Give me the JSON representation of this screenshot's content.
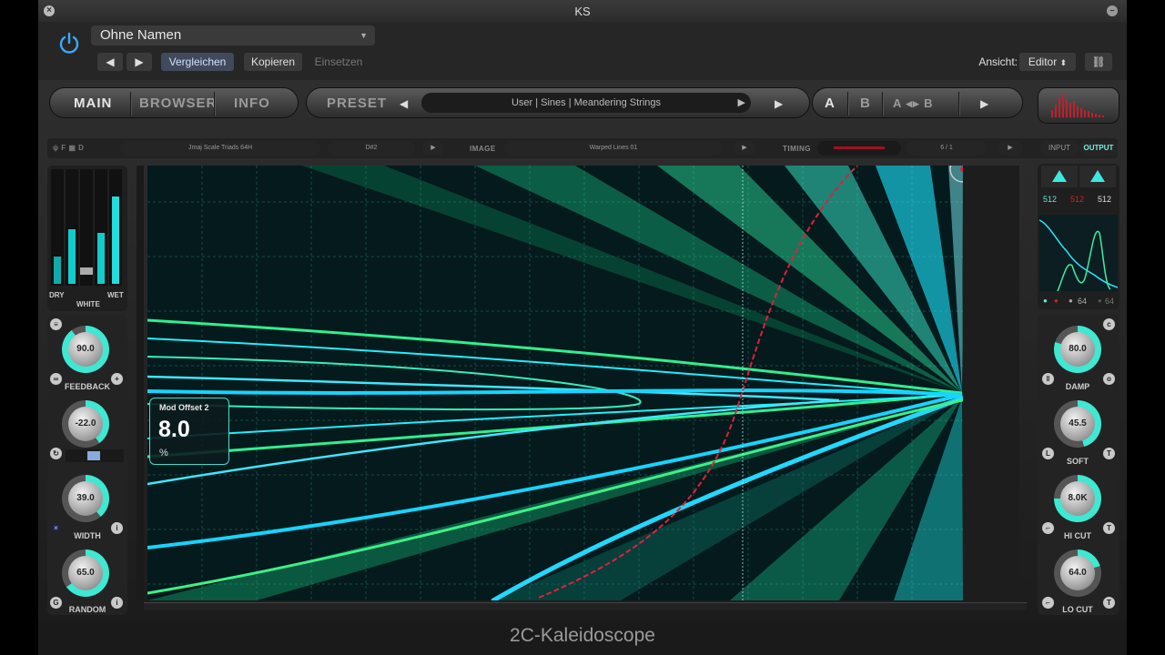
{
  "window": {
    "title": "KS"
  },
  "host": {
    "preset_name": "Ohne Namen",
    "compare_label": "Vergleichen",
    "copy_label": "Kopieren",
    "paste_label": "Einsetzen",
    "view_label": "Ansicht:",
    "view_value": "Editor"
  },
  "nav": {
    "main": "MAIN",
    "browser": "BROWSER",
    "info": "INFO",
    "preset": "PRESET",
    "a": "A",
    "b": "B",
    "ab": "A ◂▸ B"
  },
  "preset_path": "User | Sines | Meandering Strings",
  "sub": {
    "scale": "Jmaj Scale Triads 64H",
    "key": "D#2",
    "image_label": "IMAGE",
    "image_value": "Warped Lines 01",
    "timing_label": "TIMING",
    "timing_value": "6 / 1"
  },
  "left": {
    "dry": "DRY",
    "white": "WHITE",
    "wet": "WET",
    "feedback": {
      "value": "90.0",
      "label": "FEEDBACK",
      "level": 0.9
    },
    "pitch": {
      "value": "-22.0",
      "level": 0.4
    },
    "width": {
      "value": "39.0",
      "label": "WIDTH",
      "level": 0.39
    },
    "random": {
      "value": "65.0",
      "label": "RANDOM",
      "level": 0.65
    }
  },
  "tooltip": {
    "title": "Mod Offset 2",
    "value": "8.0",
    "unit": "%"
  },
  "right": {
    "input": "INPUT",
    "output": "OUTPUT",
    "n1": "512",
    "n2": "512",
    "n3": "512",
    "n4": "64",
    "n5": "64",
    "damp": {
      "value": "80.0",
      "label": "DAMP",
      "level": 0.8
    },
    "soft": {
      "value": "45.5",
      "label": "SOFT",
      "level": 0.455
    },
    "hicut": {
      "value": "8.0K",
      "label": "HI CUT",
      "level": 0.75
    },
    "locut": {
      "value": "64.0",
      "label": "LO CUT",
      "level": 0.2
    }
  },
  "colors": {
    "accent": "#3ee8d2",
    "red_curve": "#e0203a",
    "cyan": "#20e8ff",
    "green": "#36f0a0"
  },
  "footer": {
    "plugin_name": "2C-Kaleidoscope"
  }
}
